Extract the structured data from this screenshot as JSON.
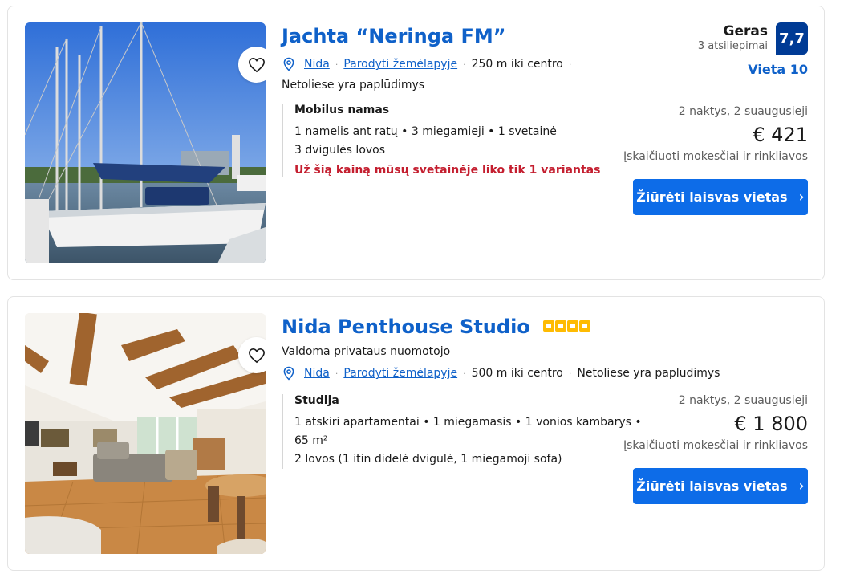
{
  "listings": [
    {
      "title": "Jachta “Neringa FM”",
      "stars": 0,
      "managed_note": "",
      "location": {
        "city": "Nida",
        "map_link": "Parodyti žemėlapyje",
        "distance": "250 m iki centro",
        "beach": "Netoliese yra paplūdimys"
      },
      "review": {
        "word": "Geras",
        "count": "3 atsiliepimai",
        "score": "7,7",
        "location_score": "Vieta 10"
      },
      "room": {
        "type": "Mobilus namas",
        "lines": [
          "1 namelis ant ratų • 3 miegamieji • 1 svetainė",
          "3 dvigulės lovos"
        ],
        "urgent": "Už šią kainą mūsų svetainėje liko tik 1 variantas"
      },
      "price": {
        "nights": "2 naktys, 2 suaugusieji",
        "amount": "€ 421",
        "taxes": "Įskaičiuoti mokesčiai ir rinkliavos"
      },
      "cta": "Žiūrėti laisvas vietas",
      "photo_icon": "sailboat-photo"
    },
    {
      "title": "Nida Penthouse Studio",
      "stars": 4,
      "managed_note": "Valdoma privataus nuomotojo",
      "location": {
        "city": "Nida",
        "map_link": "Parodyti žemėlapyje",
        "distance": "500 m iki centro",
        "beach": "Netoliese yra paplūdimys"
      },
      "review": null,
      "room": {
        "type": "Studija",
        "lines": [
          "1 atskiri apartamentai • 1 miegamasis • 1 vonios kambarys •",
          "65 m²",
          "2 lovos (1 itin didelė dvigulė, 1 miegamoji sofa)"
        ],
        "urgent": ""
      },
      "price": {
        "nights": "2 naktys, 2 suaugusieji",
        "amount": "€ 1 800",
        "taxes": "Įskaičiuoti mokesčiai ir rinkliavos"
      },
      "cta": "Žiūrėti laisvas vietas",
      "photo_icon": "living-room-photo"
    }
  ],
  "colors": {
    "link_blue": "#0f61c9",
    "score_navy": "#003b95",
    "cta_blue": "#0d6ce8",
    "urgent_red": "#c41e2f",
    "star_yellow": "#febb02"
  },
  "icons": {
    "favorite": "heart-icon",
    "location": "map-pin-icon",
    "cta_arrow": "chevron-right-icon"
  }
}
